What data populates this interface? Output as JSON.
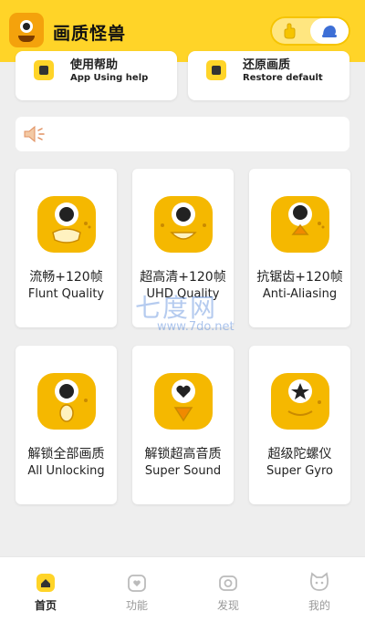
{
  "header": {
    "title": "画质怪兽",
    "toggle_left_icon": "hand-icon",
    "toggle_right_icon": "moon-icon"
  },
  "top_cards": [
    {
      "title": "使用帮助",
      "subtitle": "App Using help",
      "icon": "help-icon"
    },
    {
      "title": "还原画质",
      "subtitle": "Restore default",
      "icon": "restore-icon"
    }
  ],
  "notice": {
    "icon": "speaker-icon",
    "text": ""
  },
  "features": [
    {
      "cn": "流畅+120帧",
      "en": "Flunt Quality"
    },
    {
      "cn": "超高清+120帧",
      "en": "UHD Quality"
    },
    {
      "cn": "抗锯齿+120帧",
      "en": "Anti-Aliasing"
    },
    {
      "cn": "解锁全部画质",
      "en": "All Unlocking"
    },
    {
      "cn": "解锁超高音质",
      "en": "Super Sound"
    },
    {
      "cn": "超级陀螺仪",
      "en": "Super Gyro"
    }
  ],
  "watermark": {
    "main": "七度网",
    "url": "www.7do.net"
  },
  "bottom_nav": [
    {
      "label": "首页",
      "icon": "home-icon",
      "active": true
    },
    {
      "label": "功能",
      "icon": "heart-bag-icon",
      "active": false
    },
    {
      "label": "发现",
      "icon": "discover-icon",
      "active": false
    },
    {
      "label": "我的",
      "icon": "cat-icon",
      "active": false
    }
  ],
  "colors": {
    "accent": "#ffd428",
    "monster": "#f5b800",
    "background": "#eeeeee"
  }
}
